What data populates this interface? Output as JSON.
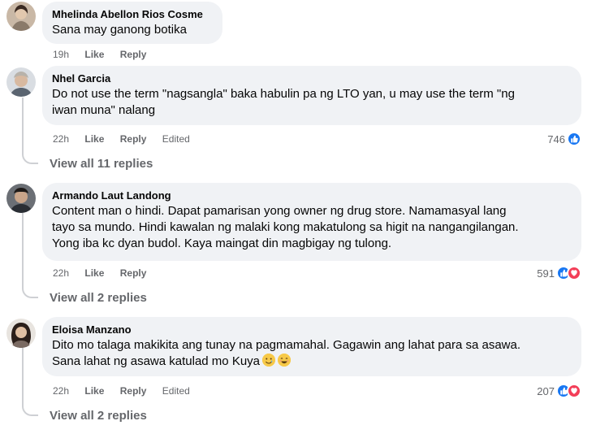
{
  "comments": [
    {
      "author": "Mhelinda Abellon Rios Cosme",
      "text": "Sana may ganong botika",
      "time": "19h",
      "like_label": "Like",
      "reply_label": "Reply"
    },
    {
      "author": "Nhel Garcia",
      "text_line1": "Do not use the term \"nagsangla\" baka habulin pa ng LTO yan, u may use the term \"ng",
      "text_line2": "iwan muna\" nalang",
      "time": "22h",
      "like_label": "Like",
      "reply_label": "Reply",
      "edited_label": "Edited",
      "reaction_count": "746",
      "reactions": [
        "like-icon"
      ],
      "view_replies": "View all 11 replies"
    },
    {
      "author": "Armando Laut Landong",
      "text_line1": "Content man o hindi. Dapat pamarisan yong owner ng drug store. Namamasyal lang",
      "text_line2": "tayo sa mundo. Hindi kawalan ng malaki kong makatulong sa higit na nangangilangan.",
      "text_line3": "Yong iba kc dyan budol. Kaya maingat din magbigay ng tulong.",
      "time": "22h",
      "like_label": "Like",
      "reply_label": "Reply",
      "reaction_count": "591",
      "reactions": [
        "like-icon",
        "love-icon"
      ],
      "view_replies": "View all 2 replies"
    },
    {
      "author": "Eloisa Manzano",
      "text_line1": "Dito mo talaga makikita ang tunay na pagmamahal. Gagawin ang lahat para sa asawa.",
      "text_line2": "Sana lahat ng asawa katulad mo Kuya",
      "time": "22h",
      "like_label": "Like",
      "reply_label": "Reply",
      "edited_label": "Edited",
      "reaction_count": "207",
      "reactions": [
        "like-icon",
        "love-icon"
      ],
      "view_replies": "View all 2 replies"
    }
  ],
  "colors": {
    "bubble": "#f0f2f5",
    "meta": "#65676b",
    "like": "#1877f2",
    "love": "#f33e58"
  }
}
